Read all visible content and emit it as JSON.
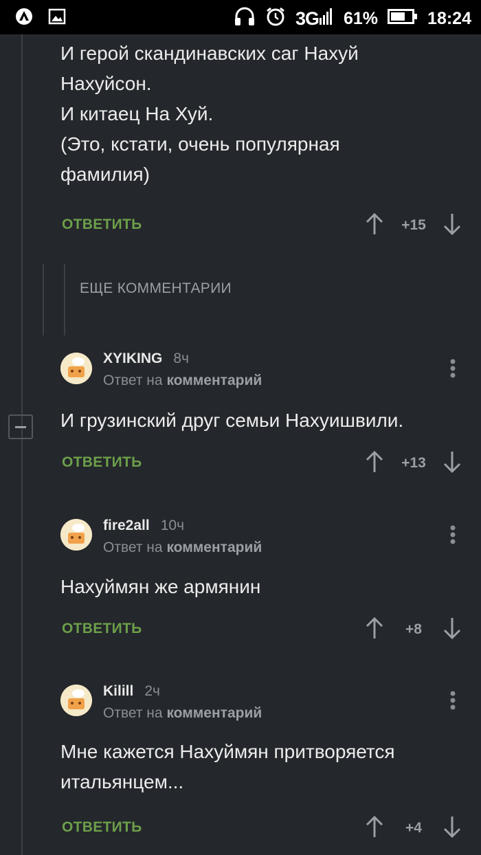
{
  "status_bar": {
    "network": "3G",
    "battery": "61%",
    "time": "18:24",
    "icons": [
      "app-logo-icon",
      "image-notification-icon",
      "headphones-icon",
      "alarm-icon",
      "signal-icon",
      "battery-icon"
    ]
  },
  "top_comment": {
    "lines": [
      "И герой скандинавских саг Нахуй",
      "Нахуйсон.",
      "И китаец На Хуй.",
      "(Это, кстати, очень популярная",
      "фамилия)"
    ],
    "reply_label": "ОТВЕТИТЬ",
    "score": "+15"
  },
  "more_comments_label": "ЕЩЕ КОММЕНТАРИИ",
  "comments": [
    {
      "username": "XYIKING",
      "time": "8ч",
      "reply_prefix": "Ответ на",
      "reply_target": "комментарий",
      "text_lines": [
        "И грузинский друг семьи Нахуишвили."
      ],
      "reply_label": "ОТВЕТИТЬ",
      "score": "+13"
    },
    {
      "username": "fire2all",
      "time": "10ч",
      "reply_prefix": "Ответ на",
      "reply_target": "комментарий",
      "text_lines": [
        "Нахуймян же армянин"
      ],
      "reply_label": "ОТВЕТИТЬ",
      "score": "+8"
    },
    {
      "username": "Kilill",
      "time": "2ч",
      "reply_prefix": "Ответ на",
      "reply_target": "комментарий",
      "text_lines": [
        "Мне кажется Нахуймян притворяется",
        "итальянцем..."
      ],
      "reply_label": "ОТВЕТИТЬ",
      "score": "+4"
    }
  ],
  "colors": {
    "background": "#24272b",
    "reply_green": "#6c9f4a",
    "muted_text": "#9aa0a6"
  }
}
